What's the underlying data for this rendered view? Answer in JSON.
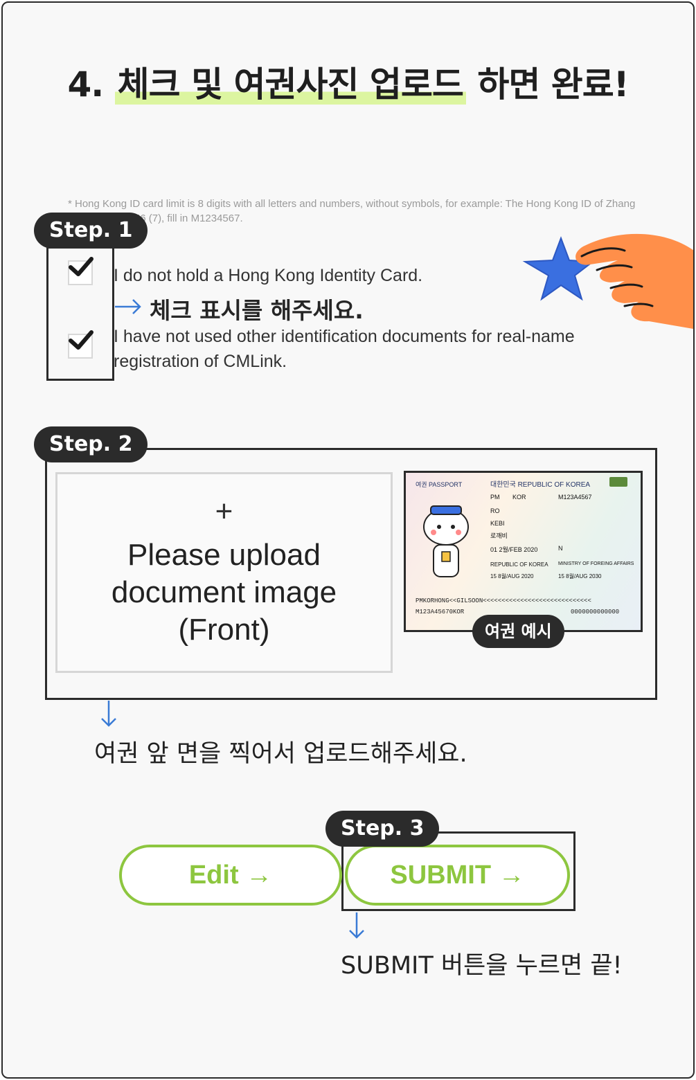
{
  "title": {
    "prefix": "4. ",
    "highlight": "체크 및 여권사진 업로드",
    "suffix": " 하면 완료!"
  },
  "note": "* Hong Kong ID card limit is 8 digits with all letters and numbers, without symbols, for example: The Hong Kong ID of Zhang SAN is M123456 (7), fill in M1234567.",
  "step1": {
    "label": "Step. 1",
    "agree1": "I do not hold a Hong Kong Identity Card.",
    "agree2": "I have not used other identification documents for real-name registration of CMLink.",
    "instruction": "체크 표시를 해주세요."
  },
  "step2": {
    "label": "Step. 2",
    "upload_plus": "+",
    "upload_text": "Please upload document image (Front)",
    "instruction": "여권 앞 면을 찍어서 업로드해주세요.",
    "example_badge": "여권 예시",
    "passport": {
      "header_left": "여권  PASSPORT",
      "header_right": "대한민국  REPUBLIC OF KOREA",
      "type": "PM",
      "country": "KOR",
      "passport_no": "M123A4567",
      "surname": "RO",
      "given_names": "KEBI",
      "korean_name": "로깨비",
      "date_of_birth": "01 2월/FEB 2020",
      "sex": "N",
      "nationality": "REPUBLIC OF KOREA",
      "authority": "MINISTRY OF FOREING AFFAIRS",
      "date_of_issue": "15 8월/AUG 2020",
      "date_of_expiry": "15 8월/AUG 2030",
      "mrz1": "PMKORHONG<<GILSOON<<<<<<<<<<<<<<<<<<<<<<<<<<<<<",
      "mrz2": "M123A45670KOR",
      "mrz2_tail": "0000000000000"
    }
  },
  "step3": {
    "label": "Step. 3",
    "edit_label": "Edit →",
    "submit_label": "SUBMIT →",
    "instruction": "SUBMIT 버튼을 누르면 끝!"
  },
  "colors": {
    "accent_green": "#8dc63f",
    "arrow_blue": "#3a7bd5",
    "highlight": "#dcf5a0",
    "dark": "#2b2b2b",
    "hand": "#ff8f4a",
    "star": "#3a6fe0"
  }
}
